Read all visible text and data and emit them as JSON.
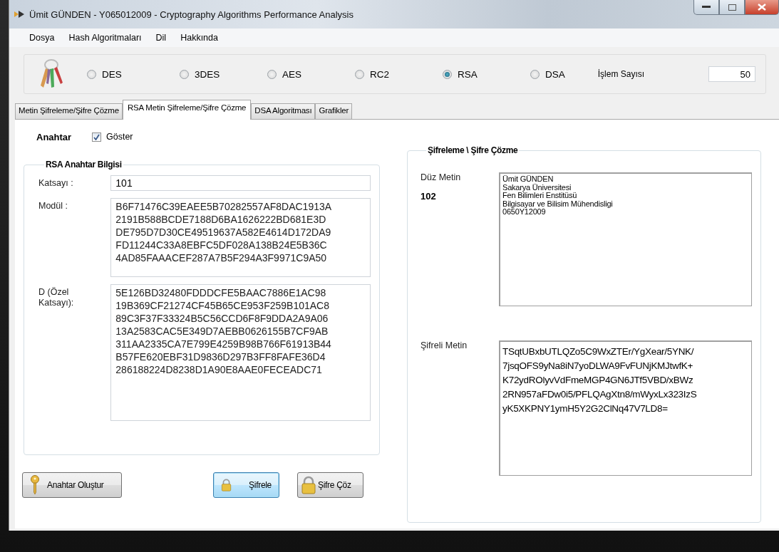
{
  "window": {
    "title": "Ümit GÜNDEN - Y065012009 - Cryptography Algorithms Performance Analysis"
  },
  "menu": [
    "Dosya",
    "Hash Algoritmaları",
    "Dil",
    "Hakkında"
  ],
  "algorithms": [
    {
      "label": "DES",
      "selected": false
    },
    {
      "label": "3DES",
      "selected": false
    },
    {
      "label": "AES",
      "selected": false
    },
    {
      "label": "RC2",
      "selected": false
    },
    {
      "label": "RSA",
      "selected": true
    },
    {
      "label": "DSA",
      "selected": false
    }
  ],
  "operation_count": {
    "label": "İşlem Sayısı",
    "value": "50"
  },
  "tabs": [
    {
      "label": "Metin Şifreleme/Şifre Çözme",
      "selected": false
    },
    {
      "label": "RSA Metin Şifreleme/Şifre Çözme",
      "selected": true
    },
    {
      "label": "DSA Algoritması",
      "selected": false
    },
    {
      "label": "Grafikler",
      "selected": false
    }
  ],
  "key": {
    "label": "Anahtar",
    "show": {
      "label": "Göster",
      "checked": true
    }
  },
  "key_info": {
    "title": "RSA Anahtar Bilgisi",
    "exponent": {
      "label": "Katsayı :",
      "value": "101"
    },
    "modulus": {
      "label": "Modül :",
      "lines": [
        "B6F71476C39EAEE5B70282557AF8DAC1913A",
        "2191B588BCDE7188D6BA1626222BD681E3D",
        "DE795D7D30CE49519637A582E4614D172DA9",
        "FD11244C33A8EBFC5DF028A138B24E5B36C",
        "4AD85FAAACEF287A7B5F294A3F9971C9A50"
      ]
    },
    "private_exponent": {
      "label": "D (Özel\nKatsayı):",
      "lines": [
        "5E126BD32480FDDDCFE5BAAC7886E1AC98",
        "19B369CF21274CF45B65CE953F259B101AC8",
        "89C3F37F33324B5C56CCD6F8F9DDA2A9A06",
        "13A2583CAC5E349D7AEBB0626155B7CF9AB",
        "311AA2335CA7E799E4259B98B766F61913B44",
        "B57FE620EBF31D9836D297B3FF8FAFE36D4",
        "286188224D8238D1A90E8AAE0FECEADC71"
      ]
    }
  },
  "buttons": [
    {
      "label": "Anahtar Oluştur",
      "kind": "key",
      "focused": false
    },
    {
      "label": "Şifrele",
      "kind": "lock",
      "focused": true
    },
    {
      "label": "Şifre Çöz",
      "kind": "lock",
      "focused": false
    }
  ],
  "crypto": {
    "title": "Şifreleme \\ Şifre Çözme",
    "plain": {
      "label": "Düz Metin",
      "char_count": "102",
      "lines": [
        "Ümit GÜNDEN",
        "Sakarya Üniversitesi",
        "Fen Bilimleri Enstitüsü",
        "Bilgisayar ve Bilisim Mühendisligi",
        "0650Y12009"
      ]
    },
    "cipher": {
      "label": "Şifreli Metin",
      "lines": [
        "TSqtUBxbUTLQZo5C9WxZTEr/YgXear/5YNK/",
        "7jsqOFS9yNa8iN7yoDLWA9FvFUNjKMJtwfK+",
        "K72ydROlyvVdFmeMGP4GN6JTf5VBD/xBWz",
        "2RN957aFDw0i5/PFLQAgXtn8/mWyxLx323IzS",
        "yK5XKPNY1ymH5Y2G2ClNq47V7LD8="
      ]
    }
  }
}
